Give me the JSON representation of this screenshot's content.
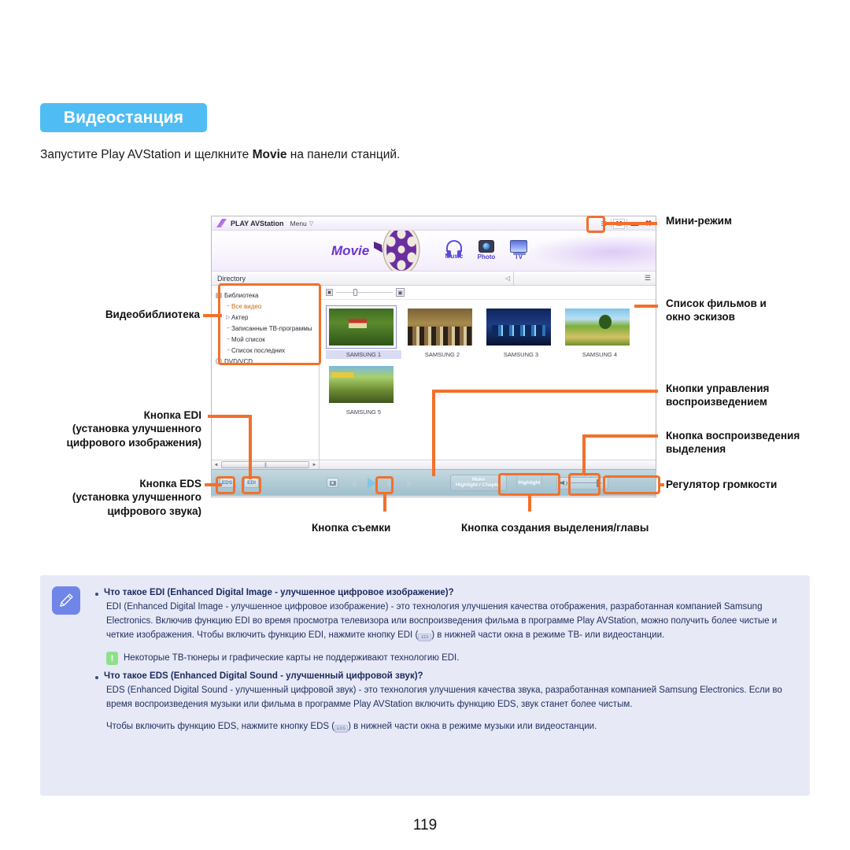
{
  "page": {
    "heading": "Видеостанция",
    "intro_prefix": "Запустите Play AVStation и щелкните ",
    "intro_bold": "Movie",
    "intro_suffix": " на панели станций.",
    "page_number": "119"
  },
  "app": {
    "titlebar": {
      "brand": "PLAY AVStation",
      "menu_label": "Menu",
      "menu_caret": "▽",
      "settings_icon": "equalizer-icon",
      "mini_mode_label": "M",
      "minimize_label": "▬",
      "close_label": "✖"
    },
    "banner": {
      "current_station": "Movie",
      "stations": [
        {
          "key": "music",
          "label": "Music",
          "icon": "headphones-icon"
        },
        {
          "key": "photo",
          "label": "Photo",
          "icon": "camera-icon"
        },
        {
          "key": "tv",
          "label": "TV",
          "icon": "television-icon"
        }
      ]
    },
    "directory": {
      "title": "Directory",
      "collapse_icon": "◁",
      "list_view_icon": "☰",
      "tree": [
        {
          "label": "Библиотека",
          "level": 1,
          "icon": "folder-icon",
          "selected": false,
          "bullet": ""
        },
        {
          "label": "Все видео",
          "level": 2,
          "icon": "",
          "selected": true,
          "bullet": "−"
        },
        {
          "label": "Актер",
          "level": 2,
          "icon": "",
          "selected": false,
          "bullet": "▷"
        },
        {
          "label": "Записанные ТВ-программы",
          "level": 2,
          "icon": "",
          "selected": false,
          "bullet": "−"
        },
        {
          "label": "Мой список",
          "level": 2,
          "icon": "",
          "selected": false,
          "bullet": "−"
        },
        {
          "label": "Список последних",
          "level": 2,
          "icon": "",
          "selected": false,
          "bullet": "−"
        },
        {
          "label": "DVD/VCD",
          "level": 1,
          "icon": "disc-icon",
          "selected": false,
          "bullet": ""
        }
      ],
      "scroll_left_icon": "◄",
      "scroll_right_icon": "►"
    },
    "zoom_strip": {
      "small_icon": "small-thumbnail-icon",
      "large_icon": "large-thumbnail-icon"
    },
    "thumbnails": [
      {
        "caption": "SAMSUNG 1",
        "selected": true
      },
      {
        "caption": "SAMSUNG 2",
        "selected": false
      },
      {
        "caption": "SAMSUNG 3",
        "selected": false
      },
      {
        "caption": "SAMSUNG 4",
        "selected": false
      },
      {
        "caption": "SAMSUNG 5",
        "selected": false
      }
    ],
    "playbar": {
      "eds_label": "EDS",
      "edi_label": "EDI",
      "capture_icon": "camera-capture-icon",
      "prev_icon": "previous-icon",
      "play_icon": "play-icon",
      "stop_icon": "stop-icon",
      "next_icon": "next-icon",
      "make_line1": "Make",
      "make_line2": "Highlight / Chapter",
      "highlight_label": "Highlight",
      "volume_icon": "speaker-icon"
    }
  },
  "callouts": {
    "mini_mode": "Мини-режим",
    "movie_list_line1": "Список фильмов и",
    "movie_list_line2": "окно эскизов",
    "playback_buttons_line1": "Кнопки управления",
    "playback_buttons_line2": "воспроизведением",
    "highlight_play_line1": "Кнопка воспроизведения",
    "highlight_play_line2": "выделения",
    "volume_control": "Регулятор громкости",
    "video_library": "Видеобиблиотека",
    "edi_line1": "Кнопка EDI",
    "edi_line2": "(установка улучшенного",
    "edi_line3": "цифрового изображения)",
    "eds_line1": "Кнопка EDS",
    "eds_line2": "(установка улучшенного",
    "eds_line3": "цифрового звука)",
    "capture_button": "Кнопка съемки",
    "make_highlight": "Кнопка создания выделения/главы"
  },
  "note": {
    "icon": "pencil-note-icon",
    "q1": "Что такое EDI (Enhanced Digital Image - улучшенное цифровое изображение)?",
    "a1_part1": "EDI (Enhanced Digital Image - улучшенное цифровое изображение) - это технология улучшения качества отображения, разработанная компанией Samsung Electronics. Включив функцию EDI во время просмотра телевизора или воспроизведения фильма в программе Play AVStation, можно получить более чистые и четкие изображения. Чтобы включить функцию EDI, нажмите кнопку EDI (",
    "a1_chip": "EDI",
    "a1_part2": ") в нижней части окна в режиме ТВ- или видеостанции.",
    "warning_icon": "exclamation-icon",
    "warning_mark": "!",
    "warning_text": "Некоторые ТВ-тюнеры и графические карты не поддерживают технологию EDI.",
    "q2": "Что такое EDS (Enhanced Digital Sound - улучшенный цифровой звук)?",
    "a2": "EDS (Enhanced Digital Sound - улучшенный цифровой звук) - это технология улучшения качества звука, разработанная компанией Samsung Electronics. Если во время воспроизведения музыки или фильма в программе Play AVStation включить функцию EDS, звук станет более чистым.",
    "a3_part1": "Чтобы включить функцию EDS, нажмите кнопку EDS (",
    "a3_chip": "EDS",
    "a3_part2": ") в нижней части окна в режиме музыки или видеостанции."
  },
  "colors": {
    "heading_bg": "#4fbdf4",
    "callout_orange": "#f2702a",
    "note_bg": "#e7e9f7",
    "note_icon_bg": "#6f86e8"
  }
}
